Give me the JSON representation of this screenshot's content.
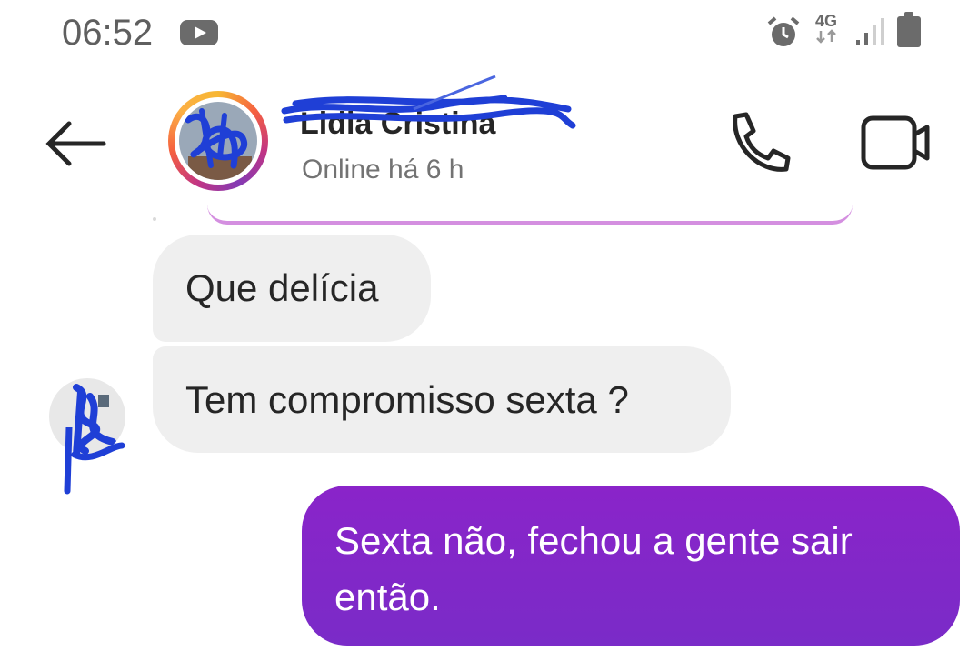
{
  "status_bar": {
    "time": "06:52",
    "network": "4G",
    "icons": [
      "youtube-icon",
      "alarm-icon",
      "data-arrows-icon",
      "signal-icon",
      "battery-icon"
    ]
  },
  "header": {
    "back_icon": "arrow-left-icon",
    "contact_name": "Lidia Cristina",
    "presence": "Online há 6 h",
    "call_icon": "phone-icon",
    "video_icon": "video-camera-icon"
  },
  "messages": [
    {
      "direction": "incoming",
      "text": "Que delícia"
    },
    {
      "direction": "incoming",
      "text": "Tem compromisso sexta ?"
    },
    {
      "direction": "outgoing",
      "text": "Sexta não, fechou a gente sair então."
    }
  ],
  "colors": {
    "incoming_bubble": "#efefef",
    "outgoing_bubble": "#8a24c9",
    "redaction": "#1f3fd6"
  }
}
